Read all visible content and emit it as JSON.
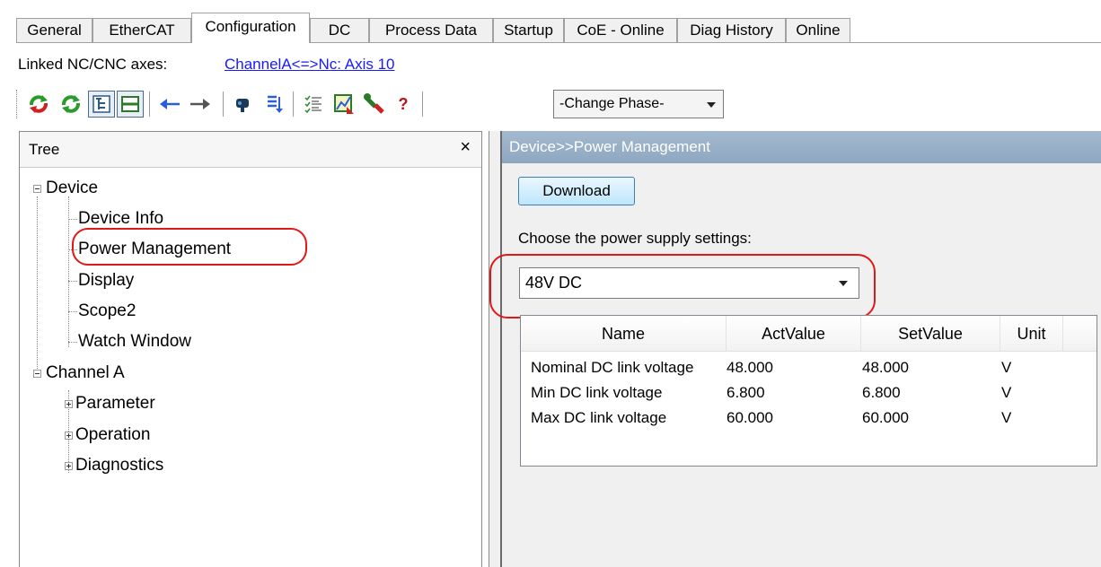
{
  "tabs": [
    {
      "label": "General",
      "active": false
    },
    {
      "label": "EtherCAT",
      "active": false
    },
    {
      "label": "Configuration",
      "active": true
    },
    {
      "label": "DC",
      "active": false
    },
    {
      "label": "Process Data",
      "active": false
    },
    {
      "label": "Startup",
      "active": false
    },
    {
      "label": "CoE - Online",
      "active": false
    },
    {
      "label": "Diag History",
      "active": false
    },
    {
      "label": "Online",
      "active": false
    }
  ],
  "linked": {
    "label": "Linked NC/CNC axes:",
    "link_text": "ChannelA<=>Nc: Axis 10"
  },
  "toolbar": {
    "icons": [
      "refresh-red-green-icon",
      "refresh-green-icon",
      "tree-view-icon",
      "split-view-icon",
      "arrow-left-icon",
      "arrow-right-icon",
      "gear-icon",
      "sort-icon",
      "list-icon",
      "chart-icon",
      "wrench-icon",
      "help-icon"
    ],
    "help_label": "?",
    "phase_combo": "-Change Phase-"
  },
  "tree": {
    "title": "Tree",
    "close_label": "×",
    "items": [
      {
        "label": "Device",
        "type": "expanded"
      },
      {
        "label": "Device Info",
        "type": "leaf"
      },
      {
        "label": "Power Management",
        "type": "leaf",
        "highlighted": true
      },
      {
        "label": "Display",
        "type": "leaf"
      },
      {
        "label": "Scope2",
        "type": "leaf"
      },
      {
        "label": "Watch Window",
        "type": "leaf"
      },
      {
        "label": "Channel A",
        "type": "expanded"
      },
      {
        "label": "Parameter",
        "type": "collapsed"
      },
      {
        "label": "Operation",
        "type": "collapsed"
      },
      {
        "label": "Diagnostics",
        "type": "collapsed"
      }
    ]
  },
  "right": {
    "header": "Device>>Power Management",
    "download_label": "Download",
    "choose_label": "Choose the power supply settings:",
    "supply_value": "48V DC"
  },
  "table": {
    "columns": [
      "Name",
      "ActValue",
      "SetValue",
      "Unit"
    ],
    "rows": [
      {
        "name": "Nominal DC link voltage",
        "act": "48.000",
        "set": "48.000",
        "unit": "V"
      },
      {
        "name": "Min DC link voltage",
        "act": "6.800",
        "set": "6.800",
        "unit": "V"
      },
      {
        "name": "Max DC link voltage",
        "act": "60.000",
        "set": "60.000",
        "unit": "V"
      }
    ]
  },
  "colors": {
    "highlight": "#e01818",
    "header_bar": "#99b0c8",
    "link": "#1a1aff"
  }
}
